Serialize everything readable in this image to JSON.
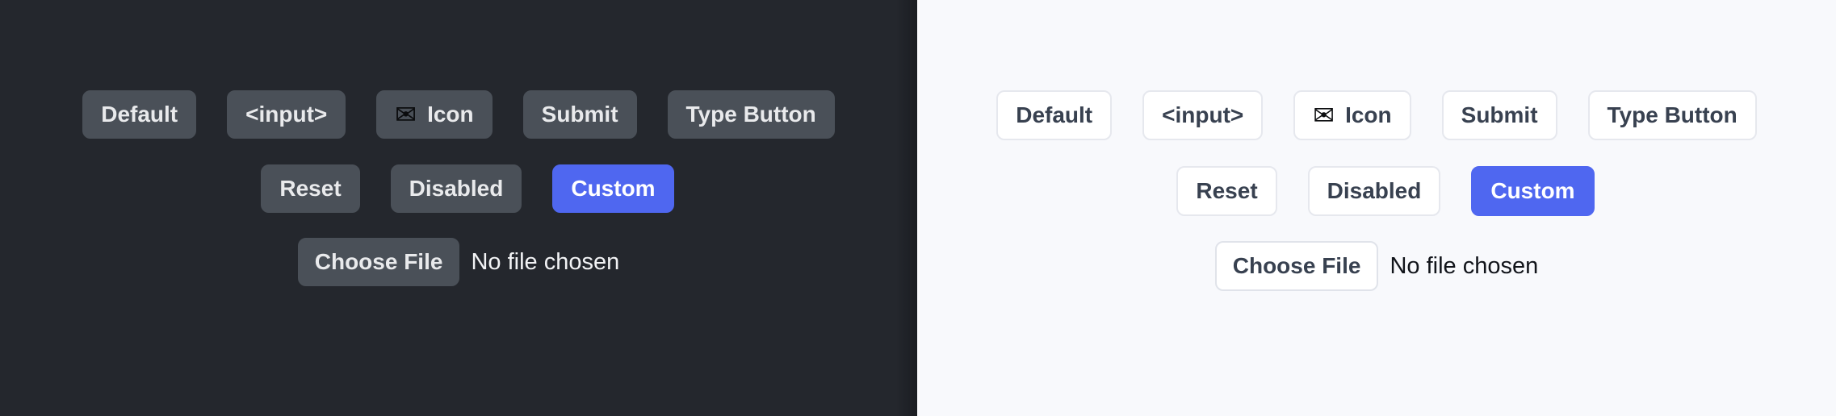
{
  "colors": {
    "dark_background": "#24272d",
    "light_background": "#f8f9fc",
    "dark_button_fill": "#4a5058",
    "dark_button_text": "#e9eaec",
    "light_button_fill": "#ffffff",
    "light_button_border": "#e6e8ee",
    "light_button_text": "#384150",
    "accent_blue": "#4f67f0",
    "accent_blue_text": "#ffffff"
  },
  "panels": [
    {
      "theme": "dark",
      "rows": [
        {
          "name": "row-primary",
          "buttons": [
            {
              "label": "Default",
              "variant": "default"
            },
            {
              "label": "<input>",
              "variant": "default"
            },
            {
              "label": "Icon",
              "variant": "icon",
              "icon": "envelope-icon",
              "icon_glyph": "✉"
            },
            {
              "label": "Submit",
              "variant": "default"
            },
            {
              "label": "Type Button",
              "variant": "default"
            }
          ]
        },
        {
          "name": "row-secondary",
          "buttons": [
            {
              "label": "Reset",
              "variant": "default"
            },
            {
              "label": "Disabled",
              "variant": "disabled"
            },
            {
              "label": "Custom",
              "variant": "custom"
            }
          ]
        }
      ],
      "file_input": {
        "button_label": "Choose File",
        "status_text": "No file chosen"
      }
    },
    {
      "theme": "light",
      "rows": [
        {
          "name": "row-primary",
          "buttons": [
            {
              "label": "Default",
              "variant": "default"
            },
            {
              "label": "<input>",
              "variant": "default"
            },
            {
              "label": "Icon",
              "variant": "icon",
              "icon": "envelope-icon",
              "icon_glyph": "✉"
            },
            {
              "label": "Submit",
              "variant": "default"
            },
            {
              "label": "Type Button",
              "variant": "default"
            }
          ]
        },
        {
          "name": "row-secondary",
          "buttons": [
            {
              "label": "Reset",
              "variant": "default"
            },
            {
              "label": "Disabled",
              "variant": "disabled"
            },
            {
              "label": "Custom",
              "variant": "custom"
            }
          ]
        }
      ],
      "file_input": {
        "button_label": "Choose File",
        "status_text": "No file chosen"
      }
    }
  ]
}
